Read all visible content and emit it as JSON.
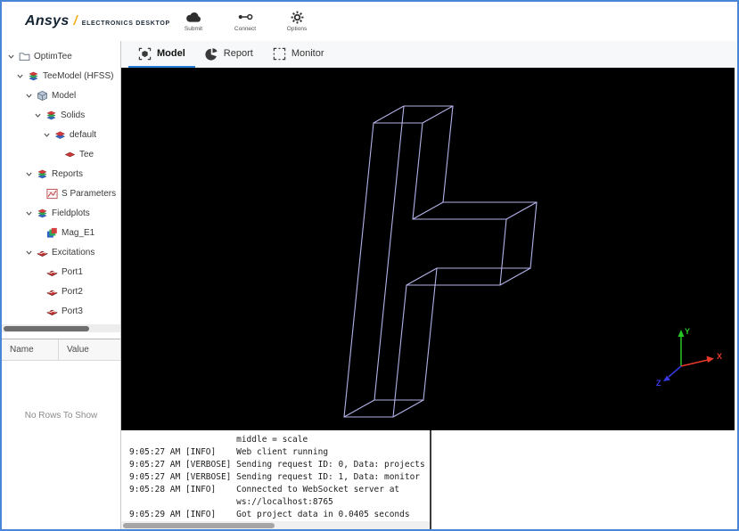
{
  "header": {
    "logo_text": "Ansys",
    "logo_slash": "/",
    "product_name": "ELECTRONICS DESKTOP",
    "toolbar": [
      {
        "label": "Submit"
      },
      {
        "label": "Connect"
      },
      {
        "label": "Options"
      }
    ]
  },
  "tabs": [
    {
      "label": "Model"
    },
    {
      "label": "Report"
    },
    {
      "label": "Monitor"
    }
  ],
  "tree": {
    "items": [
      {
        "label": "OptimTee"
      },
      {
        "label": "TeeModel (HFSS)"
      },
      {
        "label": "Model"
      },
      {
        "label": "Solids"
      },
      {
        "label": "default"
      },
      {
        "label": "Tee"
      },
      {
        "label": "Reports"
      },
      {
        "label": "S Parameters"
      },
      {
        "label": "Fieldplots"
      },
      {
        "label": "Mag_E1"
      },
      {
        "label": "Excitations"
      },
      {
        "label": "Port1"
      },
      {
        "label": "Port2"
      },
      {
        "label": "Port3"
      }
    ]
  },
  "property_grid": {
    "columns": [
      "Name",
      "Value"
    ],
    "empty_text": "No Rows To Show"
  },
  "viewport": {
    "background": "#000000",
    "wireframe_color": "#b2b2e8",
    "axes": {
      "x": "X",
      "y": "Y",
      "z": "Z"
    },
    "axis_colors": {
      "x": "#e8392a",
      "y": "#27c427",
      "z": "#3a3ae8"
    }
  },
  "console": {
    "lines": [
      "                     middle = scale",
      "9:05:27 AM [INFO]    Web client running",
      "9:05:27 AM [VERBOSE] Sending request ID: 0, Data: projects",
      "9:05:27 AM [VERBOSE] Sending request ID: 1, Data: monitor",
      "9:05:28 AM [INFO]    Connected to WebSocket server at",
      "                     ws://localhost:8765",
      "9:05:29 AM [INFO]    Got project data in 0.0405 seconds"
    ]
  }
}
